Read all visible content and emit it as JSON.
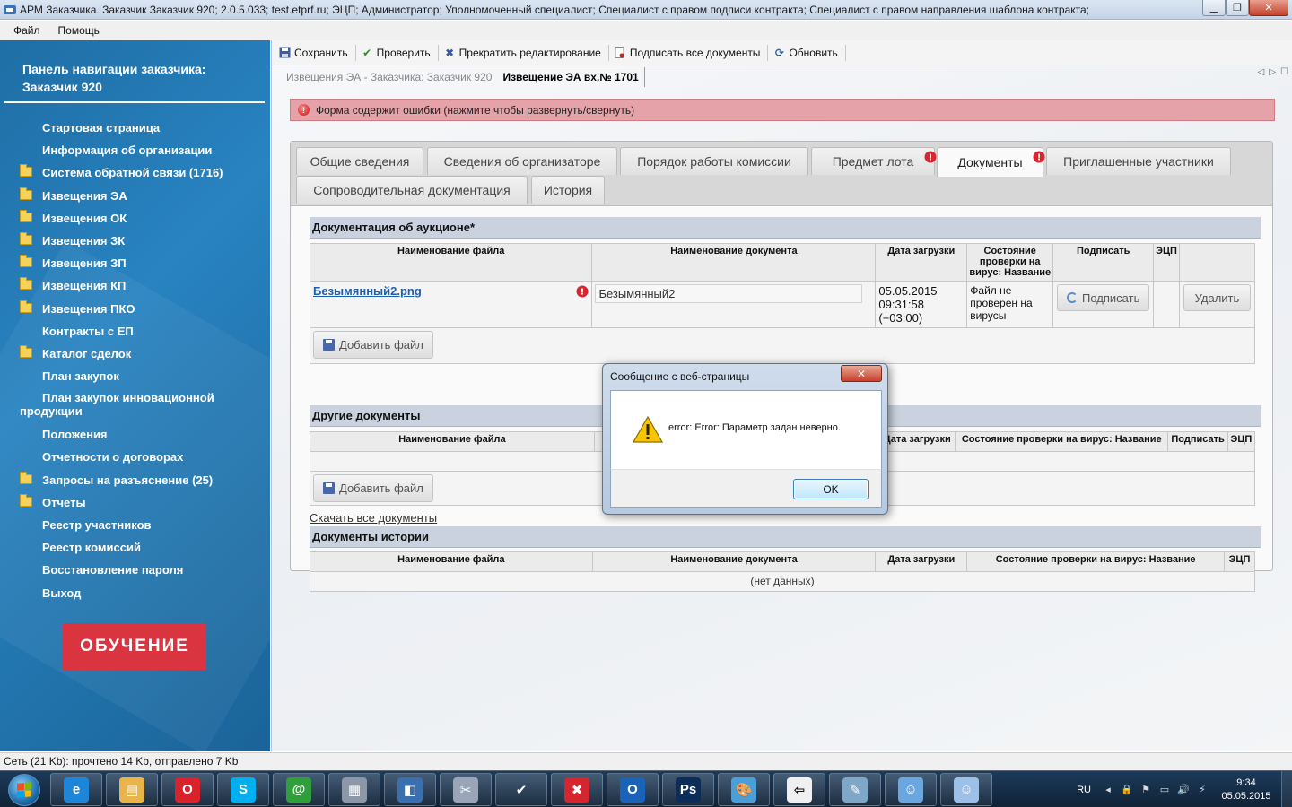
{
  "window": {
    "title": "АРМ Заказчика. Заказчик Заказчик 920; 2.0.5.033; test.etprf.ru; ЭЦП; Администратор; Уполномоченный специалист; Специалист с правом подписи контракта; Специалист с правом направления шаблона контракта;",
    "min_icon": "minimize-icon",
    "max_icon": "maximize-icon",
    "close_icon": "close-icon"
  },
  "menu": {
    "file": "Файл",
    "help": "Помощь"
  },
  "nav": {
    "title": "Панель навигации заказчика: Заказчик 920",
    "items": [
      {
        "label": "Стартовая страница",
        "folder": false
      },
      {
        "label": "Информация об организации",
        "folder": false
      },
      {
        "label": "Система обратной связи (1716)",
        "folder": true
      },
      {
        "label": "Извещения ЭА",
        "folder": true
      },
      {
        "label": "Извещения ОК",
        "folder": true
      },
      {
        "label": "Извещения ЗК",
        "folder": true
      },
      {
        "label": "Извещения ЗП",
        "folder": true
      },
      {
        "label": "Извещения КП",
        "folder": true
      },
      {
        "label": "Извещения ПКО",
        "folder": true
      },
      {
        "label": "Контракты с ЕП",
        "folder": false
      },
      {
        "label": "Каталог сделок",
        "folder": true
      },
      {
        "label": "План закупок",
        "folder": false
      },
      {
        "label": "План закупок инновационной продукции",
        "folder": false
      },
      {
        "label": "Положения",
        "folder": false
      },
      {
        "label": "Отчетности о договорах",
        "folder": false
      },
      {
        "label": "Запросы на разъяснение (25)",
        "folder": true
      },
      {
        "label": "Отчеты",
        "folder": true
      },
      {
        "label": "Реестр участников",
        "folder": false
      },
      {
        "label": "Реестр комиссий",
        "folder": false
      },
      {
        "label": "Восстановление пароля",
        "folder": false
      },
      {
        "label": "Выход",
        "folder": false
      }
    ],
    "training_button": "ОБУЧЕНИЕ"
  },
  "toolbar": {
    "save": "Сохранить",
    "check": "Проверить",
    "stop_edit": "Прекратить редактирование",
    "sign_all": "Подписать все документы",
    "refresh": "Обновить"
  },
  "doc_tabs": {
    "inactive": "Извещения ЭА - Заказчика: Заказчик 920",
    "active": "Извещение ЭА вх.№ 1701"
  },
  "error_bar": {
    "text": "Форма содержит ошибки (нажмите чтобы развернуть/свернуть)"
  },
  "tabs": {
    "general": "Общие сведения",
    "organizer": "Сведения об организаторе",
    "commission": "Порядок работы комиссии",
    "lot": "Предмет лота",
    "documents": "Документы",
    "invited": "Приглашенные участники",
    "accompanying": "Сопроводительная документация",
    "history": "История"
  },
  "auction_docs": {
    "title": "Документация об аукционе*",
    "columns": {
      "file_name": "Наименование файла",
      "doc_name": "Наименование документа",
      "upload_date": "Дата загрузки",
      "virus_check": "Состояние проверки на вирус: Название",
      "sign": "Подписать",
      "ecp": "ЭЦП"
    },
    "row": {
      "file": "Безымянный2.png",
      "doc_name": "Безымянный2",
      "date": "05.05.2015 09:31:58 (+03:00)",
      "virus": "Файл не проверен на вирусы",
      "sign_button": "Подписать",
      "delete_button": "Удалить"
    },
    "add_file": "Добавить файл"
  },
  "other_docs": {
    "title": "Другие документы",
    "columns": {
      "file_name": "Наименование файла",
      "upload_date": "Дата загрузки",
      "virus_check": "Состояние проверки на вирус: Название",
      "sign": "Подписать",
      "ecp": "ЭЦП"
    },
    "add_file": "Добавить файл"
  },
  "download_all": "Скачать все документы",
  "history_docs": {
    "title": "Документы истории",
    "columns": {
      "file_name": "Наименование файла",
      "doc_name": "Наименование документа",
      "upload_date": "Дата загрузки",
      "virus_check": "Состояние проверки на вирус: Название",
      "ecp": "ЭЦП"
    },
    "empty": "(нет данных)"
  },
  "dialog": {
    "title": "Сообщение с веб-страницы",
    "close": "✕",
    "message": "error: Error: Параметр задан неверно.",
    "ok": "OK",
    "icon": "warning-icon"
  },
  "statusbar": {
    "text": "Сеть (21 Kb):  прочтено 14 Kb, отправлено 7 Kb"
  },
  "taskbar": {
    "apps": [
      "internet-explorer-icon",
      "explorer-icon",
      "opera-icon",
      "skype-icon",
      "mail-agent-icon",
      "calculator-icon",
      "network-icon",
      "tools-icon",
      "checkmark-icon",
      "close-app-icon",
      "outlook-icon",
      "photoshop-icon",
      "paint-icon",
      "remote-icon",
      "notes-icon",
      "user-icon",
      "user2-icon"
    ],
    "lang": "RU",
    "time": "9:34",
    "date": "05.05.2015"
  }
}
